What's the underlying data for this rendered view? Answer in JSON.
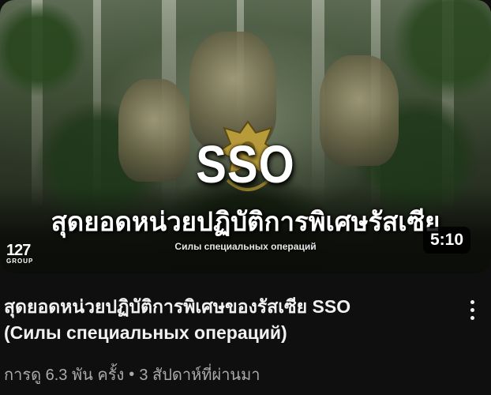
{
  "video": {
    "thumbnail": {
      "headline": "SSO",
      "thai_title": "สุดยอดหน่วยปฏิบัติการพิเศษรัสเซีย",
      "russian_subtitle": "Силы специальных операций",
      "channel_logo_number": "127",
      "channel_logo_word": "GROUP",
      "duration": "5:10"
    },
    "title_line1": "สุดยอดหน่วยปฏิบัติการพิเศษของรัสเซีย SSO",
    "title_line2": "(Силы специальных операций)",
    "views": "การดู 6.3 พัน ครั้ง",
    "separator": "•",
    "age": "3 สัปดาห์ที่ผ่านมา",
    "more_icon": "more-vert-icon"
  }
}
